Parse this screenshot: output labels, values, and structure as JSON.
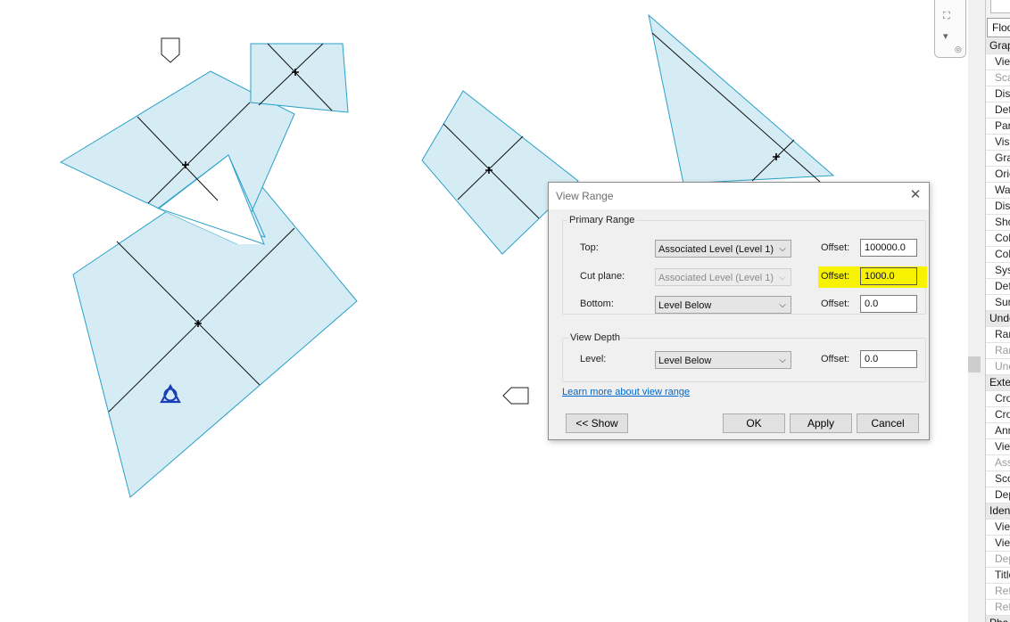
{
  "dialog": {
    "title": "View Range",
    "close_glyph": "✕",
    "primary_range": {
      "legend": "Primary Range",
      "top": {
        "label": "Top:",
        "level": "Associated Level (Level 1)",
        "offset_label": "Offset:",
        "offset": "100000.0"
      },
      "cut_plane": {
        "label": "Cut plane:",
        "level": "Associated Level (Level 1)",
        "offset_label": "Offset:",
        "offset": "1000.0"
      },
      "bottom": {
        "label": "Bottom:",
        "level": "Level Below",
        "offset_label": "Offset:",
        "offset": "0.0"
      }
    },
    "view_depth": {
      "legend": "View Depth",
      "level": {
        "label": "Level:",
        "level": "Level Below",
        "offset_label": "Offset:",
        "offset": "0.0"
      }
    },
    "learn_more": "Learn more about view range",
    "buttons": {
      "show": "<< Show",
      "ok": "OK",
      "apply": "Apply",
      "cancel": "Cancel"
    },
    "highlight_color": "#f7f200"
  },
  "properties": {
    "type_selector": "Floo",
    "rows": [
      {
        "t": "Grap",
        "kind": "hdr"
      },
      {
        "t": "Viev",
        "kind": "row"
      },
      {
        "t": "Scal",
        "kind": "grey"
      },
      {
        "t": "Disp",
        "kind": "row"
      },
      {
        "t": "Deta",
        "kind": "row"
      },
      {
        "t": "Part",
        "kind": "row"
      },
      {
        "t": "Visi",
        "kind": "row"
      },
      {
        "t": "Grap",
        "kind": "row"
      },
      {
        "t": "Orie",
        "kind": "row"
      },
      {
        "t": "Wal",
        "kind": "row"
      },
      {
        "t": "Disc",
        "kind": "row"
      },
      {
        "t": "Sho",
        "kind": "row"
      },
      {
        "t": "Colc",
        "kind": "row"
      },
      {
        "t": "Colc",
        "kind": "row"
      },
      {
        "t": "Syst",
        "kind": "row"
      },
      {
        "t": "Defa",
        "kind": "row"
      },
      {
        "t": "Sun",
        "kind": "row"
      },
      {
        "t": "Unde",
        "kind": "hdr"
      },
      {
        "t": "Ran",
        "kind": "row"
      },
      {
        "t": "Ran",
        "kind": "grey"
      },
      {
        "t": "Und",
        "kind": "grey"
      },
      {
        "t": "Exter",
        "kind": "hdr"
      },
      {
        "t": "Cro",
        "kind": "row"
      },
      {
        "t": "Cro",
        "kind": "row"
      },
      {
        "t": "Ann",
        "kind": "row"
      },
      {
        "t": "Viev",
        "kind": "row"
      },
      {
        "t": "Asso",
        "kind": "grey"
      },
      {
        "t": "Sco",
        "kind": "row"
      },
      {
        "t": "Dep",
        "kind": "row"
      },
      {
        "t": "Iden",
        "kind": "hdr"
      },
      {
        "t": "Viev",
        "kind": "row"
      },
      {
        "t": "Viev",
        "kind": "row"
      },
      {
        "t": "Dep",
        "kind": "grey"
      },
      {
        "t": "Title",
        "kind": "row"
      },
      {
        "t": "Ref",
        "kind": "grey"
      },
      {
        "t": "Ref",
        "kind": "grey"
      },
      {
        "t": "Pha",
        "kind": "hdr"
      }
    ]
  },
  "canvas": {
    "fill_color": "#d6ecf5",
    "edge_color": "#2aa0c8",
    "marker_color": "#1a3fb5"
  }
}
